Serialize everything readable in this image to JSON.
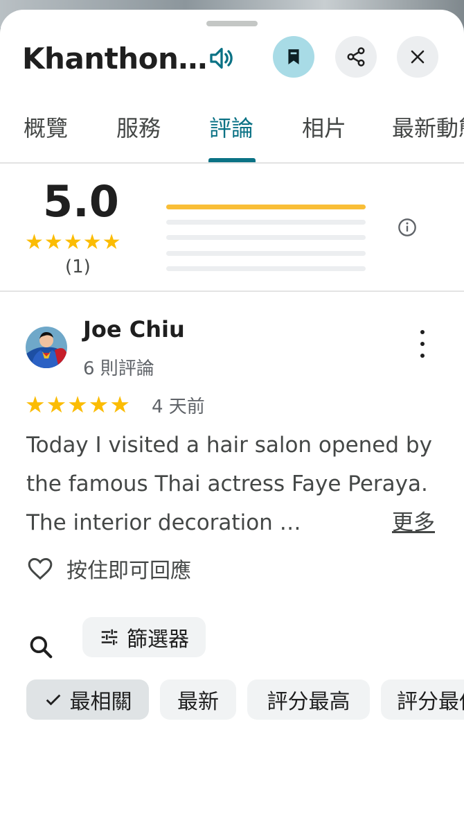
{
  "place": {
    "title": "Khanthon…"
  },
  "header": {
    "icons": [
      "speaker-icon",
      "bookmark-icon",
      "share-icon",
      "close-icon"
    ],
    "save_active_color": "#a8dbe6"
  },
  "tabs": [
    {
      "label": "概覽"
    },
    {
      "label": "服務"
    },
    {
      "label": "評論"
    },
    {
      "label": "相片"
    },
    {
      "label": "最新動態"
    }
  ],
  "active_tab": "評論",
  "summary": {
    "rating": "5.0",
    "stars": 5,
    "count": "(1)",
    "distribution_fraction": [
      1.0,
      0.0,
      0.0,
      0.0,
      0.0
    ],
    "star_color": "#fbbc04",
    "bar_color": "#f9be37"
  },
  "review": {
    "author": "Joe Chiu",
    "author_sub": "6 則評論",
    "stars": 5,
    "date": "4 天前",
    "text": "Today I visited a hair salon opened by the famous Thai actress Faye Peraya. The interior decoration …",
    "more_label": "更多",
    "like_label": "按住即可回應"
  },
  "filters": {
    "filter_label": "篩選器",
    "sort_chips": [
      {
        "label": "最相關",
        "selected": true
      },
      {
        "label": "最新",
        "selected": false
      },
      {
        "label": "評分最高",
        "selected": false
      },
      {
        "label": "評分最低",
        "selected": false
      }
    ]
  },
  "accent_color": "#0b7285"
}
